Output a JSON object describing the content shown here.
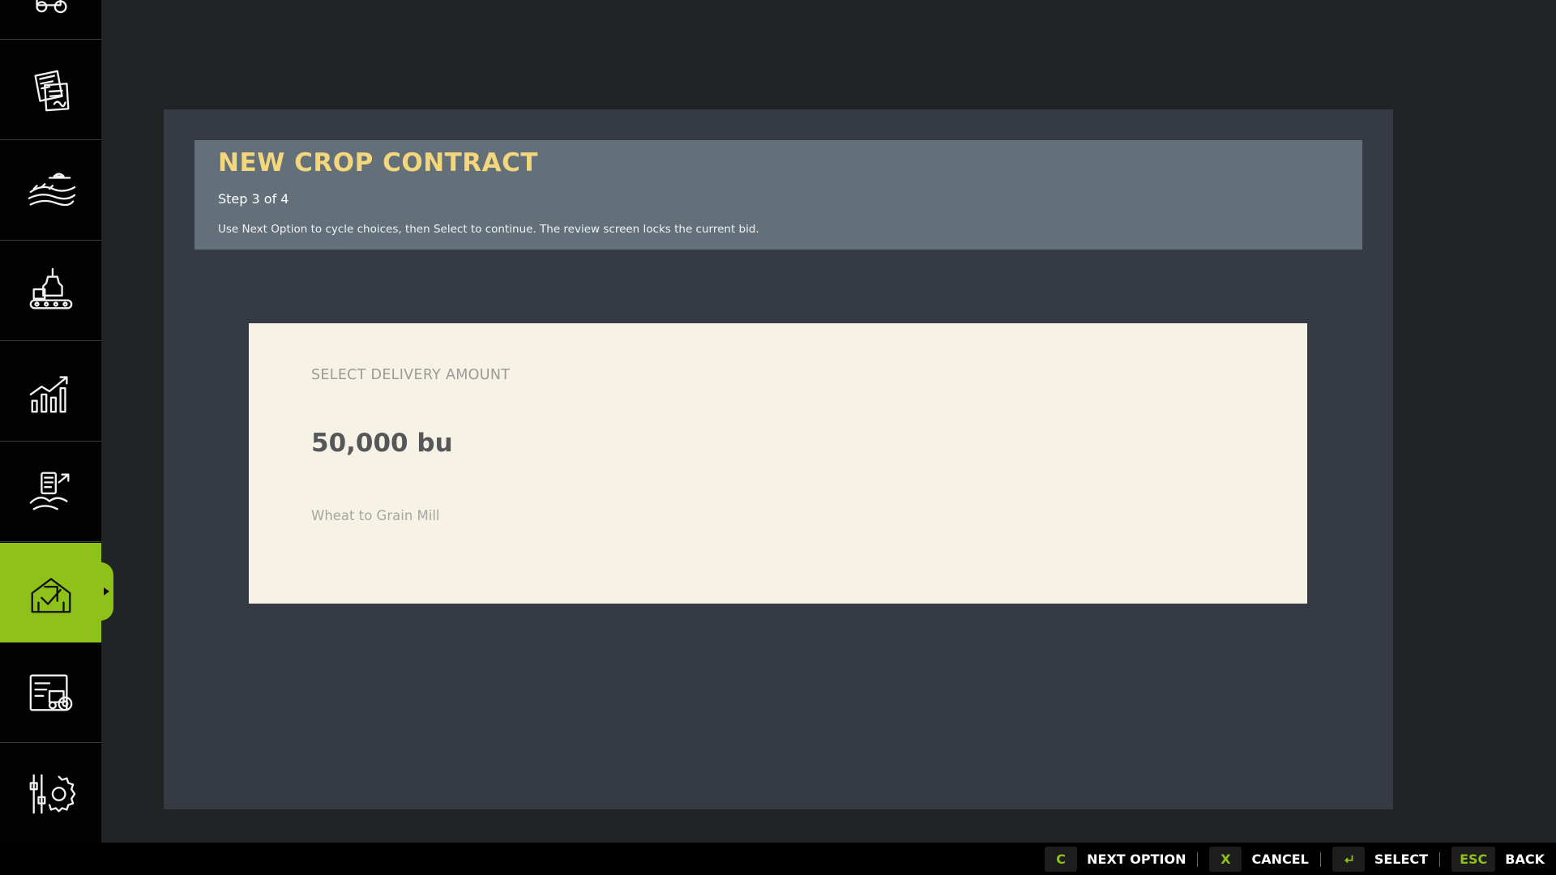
{
  "header": {
    "title": "NEW CROP CONTRACT",
    "step": "Step 3 of 4",
    "hint": "Use Next Option to cycle choices, then Select to continue. The review screen locks the current bid."
  },
  "card": {
    "label": "SELECT DELIVERY AMOUNT",
    "value": "50,000 bu",
    "subtitle": "Wheat to Grain Mill"
  },
  "sidebar": {
    "items": [
      {
        "icon": "tractor-icon"
      },
      {
        "icon": "contracts-document-icon"
      },
      {
        "icon": "fields-icon"
      },
      {
        "icon": "production-icon"
      },
      {
        "icon": "prices-chart-icon"
      },
      {
        "icon": "finances-icon"
      },
      {
        "icon": "contract-market-icon",
        "active": true
      },
      {
        "icon": "vehicle-shop-icon"
      },
      {
        "icon": "settings-icon"
      }
    ]
  },
  "footer": {
    "hints": [
      {
        "key": "C",
        "label": "NEXT OPTION"
      },
      {
        "key": "X",
        "label": "CANCEL"
      },
      {
        "key": "",
        "icon": "enter-key-icon",
        "label": "SELECT"
      },
      {
        "key": "ESC",
        "label": "BACK"
      }
    ]
  },
  "colors": {
    "accent": "#8ec21b",
    "title": "#f4d77c",
    "panel": "#363a42",
    "header": "#637079",
    "card": "#f6f2e6"
  }
}
